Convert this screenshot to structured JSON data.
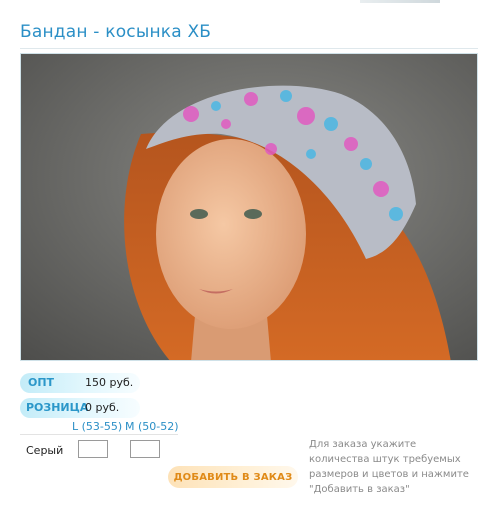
{
  "product": {
    "title": "Бандан - косынка ХБ"
  },
  "photo": {
    "description_icon": "product-photo"
  },
  "prices": {
    "opt_label": "ОПТ",
    "opt_value": "150 руб.",
    "retail_label": "РОЗНИЦА",
    "retail_value": "0 руб."
  },
  "sizes": {
    "size_l": "L (53-55)",
    "size_m": "M (50-52)"
  },
  "colors": [
    {
      "name": "Серый",
      "qty_l": "",
      "qty_m": ""
    }
  ],
  "order": {
    "button_label": "ДОБАВИТЬ В ЗАКАЗ",
    "hint": "Для заказа укажите количества штук требуемых размеров и цветов и нажмите \"Добавить в заказ\""
  },
  "theme": {
    "accent": "#2b8fc6",
    "order_text": "#e08a17"
  }
}
